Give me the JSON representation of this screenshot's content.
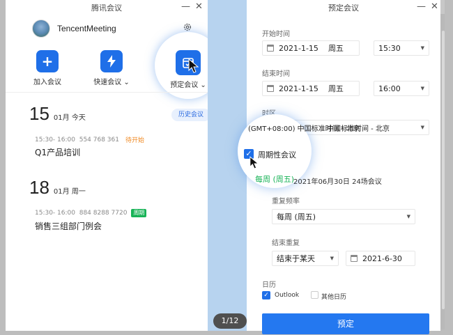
{
  "left_window": {
    "title": "腾讯会议",
    "user_name": "TencentMeeting",
    "actions": [
      {
        "label": "加入会议",
        "icon": "plus-icon"
      },
      {
        "label": "快速会议",
        "icon": "lightning-icon",
        "caret": "⌄"
      },
      {
        "label": "预定会议",
        "icon": "calendar-icon",
        "caret": "⌄"
      }
    ],
    "history_button": "历史会议",
    "days": [
      {
        "day": "15",
        "date": "01月 今天",
        "meeting": {
          "time": "15:30- 16:00",
          "id": "554 768 361",
          "tag": "待开始",
          "title": "Q1产品培训"
        }
      },
      {
        "day": "18",
        "date": "01月 周一",
        "meeting": {
          "time": "15:30- 16:00",
          "id": "884 8288 7720",
          "tag": "周期",
          "title": "销售三组部门例会"
        }
      }
    ]
  },
  "pager": "1/12",
  "right_window": {
    "title": "预定会议",
    "start_label": "开始时间",
    "start_date": "2021-1-15",
    "start_weekday": "周五",
    "start_time": "15:30",
    "end_label": "结束时间",
    "end_date": "2021-1-15",
    "end_weekday": "周五",
    "end_time": "16:00",
    "timezone_label": "时区",
    "timezone_value": "(GMT+08:00) 中国标准时间 - 北京",
    "recurring_label": "周期性会议",
    "recurring_summary_tag": "每周 (周五)",
    "recurring_summary_text": "2021年06月30日 24场会议",
    "frequency_label": "重复频率",
    "frequency_value": "每周 (周五)",
    "end_repeat_label": "结束重复",
    "end_repeat_mode": "结束于某天",
    "end_repeat_date": "2021-6-30",
    "calendar_label": "日历",
    "calendar_outlook": "Outlook",
    "calendar_other": "其他日历",
    "submit_label": "预定"
  },
  "colors": {
    "accent": "#1f6fe8",
    "recurring_tag": "#18b357",
    "pending_tag": "#f08a24"
  }
}
